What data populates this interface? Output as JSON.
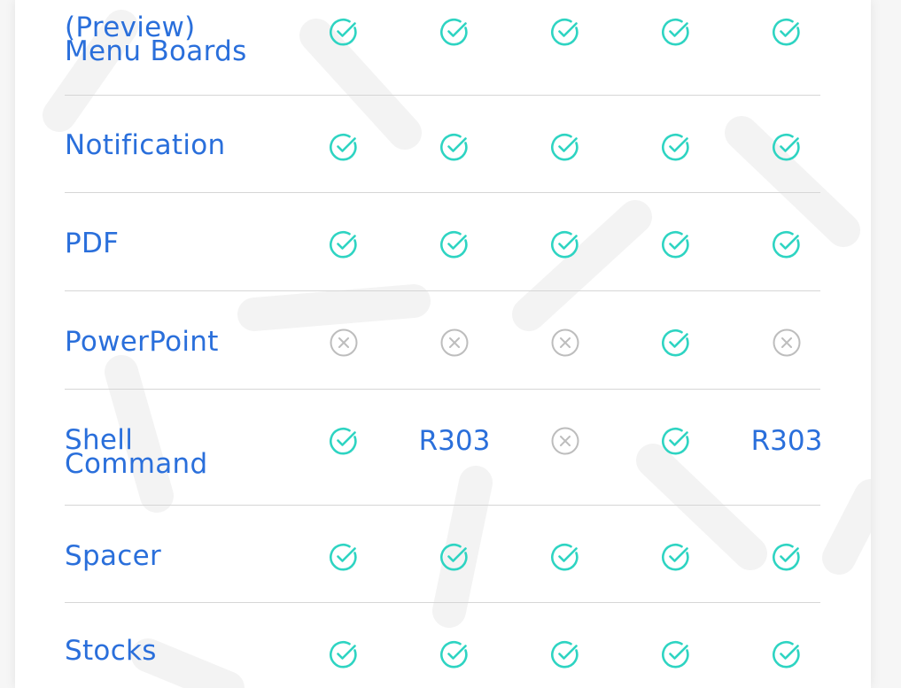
{
  "colors": {
    "label": "#2a6fdb",
    "check": "#2ed4c2",
    "cross": "#bdbdbd",
    "divider": "#d6d6d6"
  },
  "icons": {
    "check": "check-circle-icon",
    "cross": "x-circle-icon"
  },
  "rows": [
    {
      "label_lines": [
        "(Preview)",
        "Menu Boards"
      ],
      "cells": [
        {
          "type": "check"
        },
        {
          "type": "check"
        },
        {
          "type": "check"
        },
        {
          "type": "check"
        },
        {
          "type": "check"
        }
      ]
    },
    {
      "label_lines": [
        "Notification"
      ],
      "cells": [
        {
          "type": "check"
        },
        {
          "type": "check"
        },
        {
          "type": "check"
        },
        {
          "type": "check"
        },
        {
          "type": "check"
        }
      ]
    },
    {
      "label_lines": [
        "PDF"
      ],
      "cells": [
        {
          "type": "check"
        },
        {
          "type": "check"
        },
        {
          "type": "check"
        },
        {
          "type": "check"
        },
        {
          "type": "check"
        }
      ]
    },
    {
      "label_lines": [
        "PowerPoint"
      ],
      "cells": [
        {
          "type": "cross"
        },
        {
          "type": "cross"
        },
        {
          "type": "cross"
        },
        {
          "type": "check"
        },
        {
          "type": "cross"
        }
      ]
    },
    {
      "label_lines": [
        "Shell",
        "Command"
      ],
      "cells": [
        {
          "type": "check"
        },
        {
          "type": "text",
          "text": "R303"
        },
        {
          "type": "cross"
        },
        {
          "type": "check"
        },
        {
          "type": "text",
          "text": "R303"
        }
      ]
    },
    {
      "label_lines": [
        "Spacer"
      ],
      "cells": [
        {
          "type": "check"
        },
        {
          "type": "check"
        },
        {
          "type": "check"
        },
        {
          "type": "check"
        },
        {
          "type": "check"
        }
      ]
    },
    {
      "label_lines": [
        "Stocks"
      ],
      "cells": [
        {
          "type": "check"
        },
        {
          "type": "check"
        },
        {
          "type": "check"
        },
        {
          "type": "check"
        },
        {
          "type": "check"
        }
      ]
    }
  ]
}
